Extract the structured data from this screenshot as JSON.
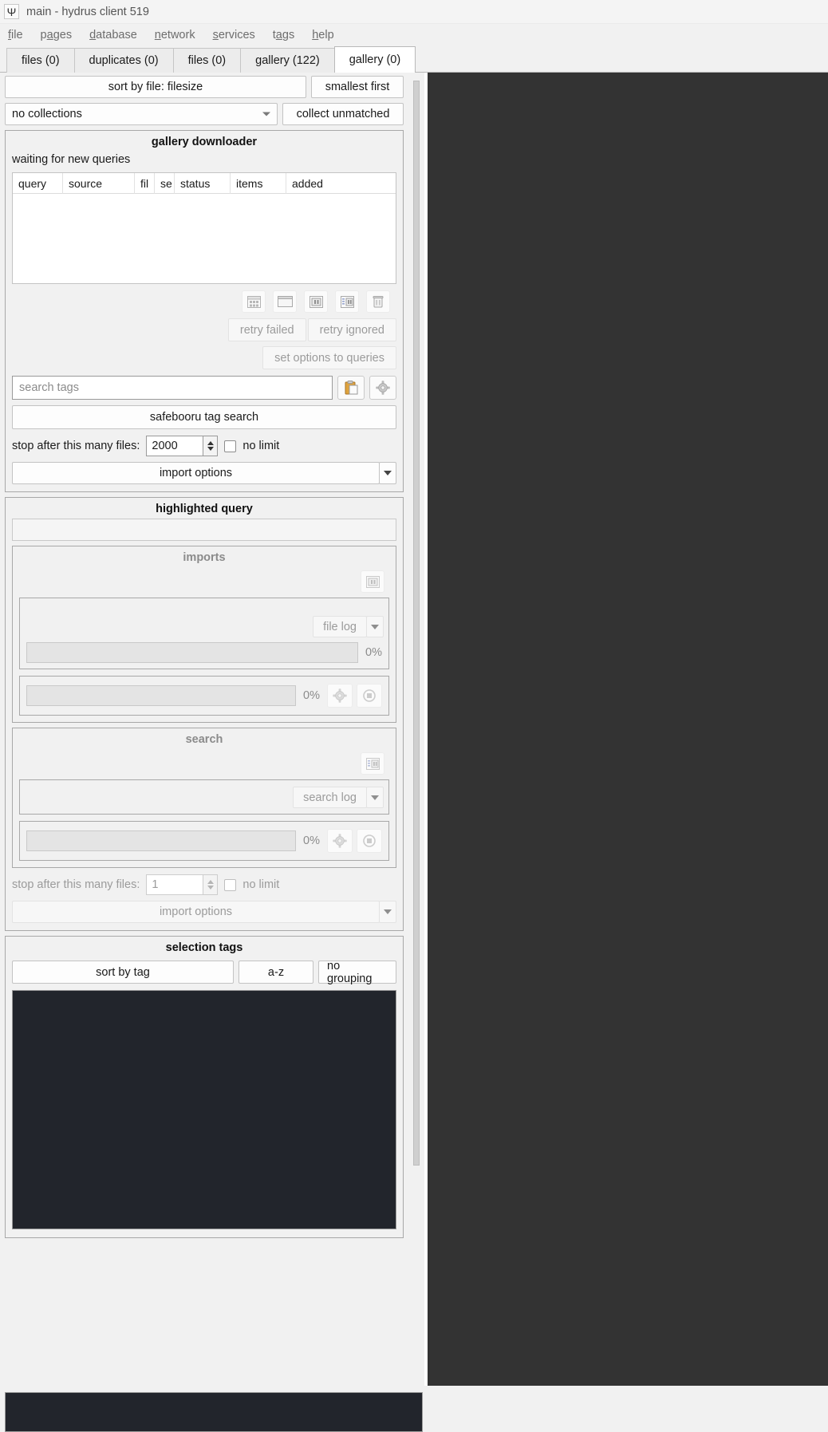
{
  "window": {
    "title": "main - hydrus client 519",
    "icon": "psi-icon"
  },
  "menubar": [
    {
      "label": "file"
    },
    {
      "label": "pages"
    },
    {
      "label": "database"
    },
    {
      "label": "network"
    },
    {
      "label": "services"
    },
    {
      "label": "tags"
    },
    {
      "label": "help"
    }
  ],
  "tabs": [
    {
      "label": "files (0)",
      "active": false
    },
    {
      "label": "duplicates (0)",
      "active": false
    },
    {
      "label": "files (0)",
      "active": false
    },
    {
      "label": "gallery (122)",
      "active": false
    },
    {
      "label": "gallery (0)",
      "active": true
    }
  ],
  "toolbar": {
    "sort_button": "sort by file: filesize",
    "order_button": "smallest first",
    "collections_select": "no collections",
    "collect_unmatched_button": "collect unmatched"
  },
  "gallery_downloader": {
    "title": "gallery downloader",
    "status": "waiting for new queries",
    "columns": [
      "query",
      "source",
      "fil",
      "se",
      "status",
      "items",
      "added"
    ],
    "rows": [],
    "icon_buttons": [
      "grid-view-icon",
      "window-icon",
      "pause-file-icon",
      "pause-gallery-icon",
      "trash-icon"
    ],
    "retry_failed_button": "retry failed",
    "retry_ignored_button": "retry ignored",
    "set_options_button": "set options to queries",
    "search_input_placeholder": "search tags",
    "search_input_value": "",
    "paste_icon": "clipboard-icon",
    "cog_icon": "gear-icon",
    "tag_search_button": "safebooru tag search",
    "stop_after_label": "stop after this many files:",
    "stop_after_value": "2000",
    "no_limit_label": "no limit",
    "import_options_button": "import options"
  },
  "highlighted_query": {
    "title": "highlighted query",
    "imports": {
      "title": "imports",
      "icon": "pause-file-icon",
      "file_log_button": "file log",
      "file_log_dropdown": "chevron-down-icon",
      "progress_percent": "0%",
      "sub_progress_percent": "0%",
      "gear_icon": "gear-icon",
      "stop_icon": "stop-icon"
    },
    "search": {
      "title": "search",
      "icon": "pause-gallery-icon",
      "search_log_button": "search log",
      "search_log_dropdown": "chevron-down-icon",
      "sub_progress_percent": "0%",
      "gear_icon": "gear-icon",
      "stop_icon": "stop-icon"
    },
    "stop_after_label": "stop after this many files:",
    "stop_after_value": "1",
    "no_limit_label": "no limit",
    "import_options_button": "import options"
  },
  "selection_tags": {
    "title": "selection tags",
    "sort_button": "sort by tag",
    "az_button": "a-z",
    "grouping_button": "no grouping",
    "tags": []
  },
  "colors": {
    "accent": "#f1f1f1",
    "tag_list_bg": "#22252c",
    "media_bg": "#333333",
    "clipboard_icon": "#e0a33c"
  }
}
